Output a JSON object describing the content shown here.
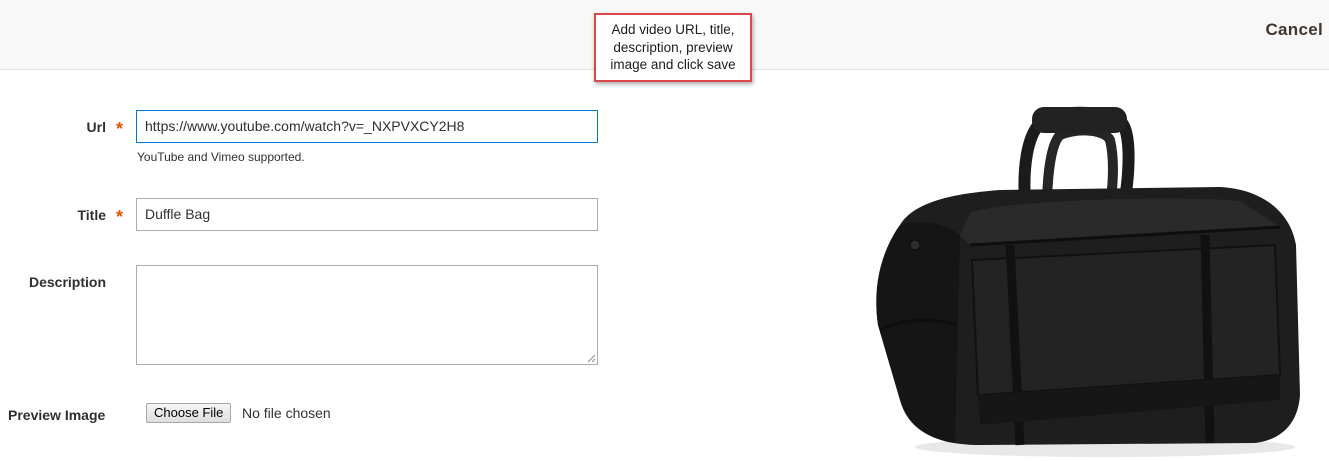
{
  "header": {
    "cancel_label": "Cancel"
  },
  "callout": {
    "text": "Add video URL, title, description, preview image and click save"
  },
  "form": {
    "url": {
      "label": "Url",
      "required_mark": "*",
      "value": "https://www.youtube.com/watch?v=_NXPVXCY2H8",
      "note": "YouTube and Vimeo supported."
    },
    "title": {
      "label": "Title",
      "required_mark": "*",
      "value": "Duffle Bag"
    },
    "description": {
      "label": "Description",
      "value": ""
    },
    "preview_image": {
      "label": "Preview Image",
      "button_label": "Choose File",
      "status": "No file chosen"
    }
  },
  "colors": {
    "required": "#eb5202",
    "focus_border": "#007bdb",
    "callout_border": "#d9494c"
  },
  "product_image": {
    "icon": "duffle-bag-image"
  }
}
